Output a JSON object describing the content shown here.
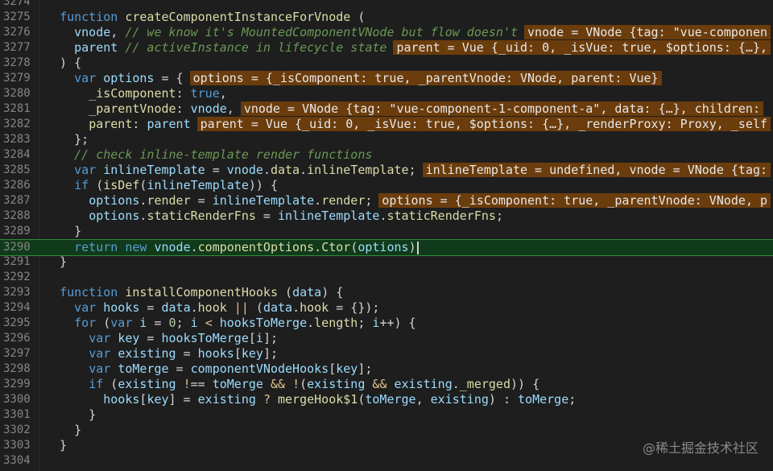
{
  "lines": [
    {
      "n": "3274",
      "t": ""
    },
    {
      "n": "3275",
      "t": "  function createComponentInstanceForVnode ("
    },
    {
      "n": "3276",
      "t": "    vnode, // we know it's MountedComponentVNode but flow doesn't",
      "inline": "vnode = VNode {tag: \"vue-componen"
    },
    {
      "n": "3277",
      "t": "    parent // activeInstance in lifecycle state",
      "inline": "parent = Vue {_uid: 0, _isVue: true, $options: {…},"
    },
    {
      "n": "3278",
      "t": "  ) {"
    },
    {
      "n": "3279",
      "t": "    var options = {",
      "inline": "options = {_isComponent: true, _parentVnode: VNode, parent: Vue}"
    },
    {
      "n": "3280",
      "t": "      _isComponent: true,"
    },
    {
      "n": "3281",
      "t": "      _parentVnode: vnode,",
      "inline": "vnode = VNode {tag: \"vue-component-1-component-a\", data: {…}, children:"
    },
    {
      "n": "3282",
      "t": "      parent: parent",
      "inline": "parent = Vue {_uid: 0, _isVue: true, $options: {…}, _renderProxy: Proxy, _self"
    },
    {
      "n": "3283",
      "t": "    };"
    },
    {
      "n": "3284",
      "t": "    // check inline-template render functions"
    },
    {
      "n": "3285",
      "t": "    var inlineTemplate = vnode.data.inlineTemplate;",
      "inline": "inlineTemplate = undefined, vnode = VNode {tag:"
    },
    {
      "n": "3286",
      "t": "    if (isDef(inlineTemplate)) {"
    },
    {
      "n": "3287",
      "t": "      options.render = inlineTemplate.render;",
      "inline": "options = {_isComponent: true, _parentVnode: VNode, p"
    },
    {
      "n": "3288",
      "t": "      options.staticRenderFns = inlineTemplate.staticRenderFns;"
    },
    {
      "n": "3289",
      "t": "    }"
    },
    {
      "n": "3290",
      "t": "    return new vnode.componentOptions.Ctor(options)",
      "current": true
    },
    {
      "n": "3291",
      "t": "  }"
    },
    {
      "n": "3292",
      "t": ""
    },
    {
      "n": "3293",
      "t": "  function installComponentHooks (data) {"
    },
    {
      "n": "3294",
      "t": "    var hooks = data.hook || (data.hook = {});"
    },
    {
      "n": "3295",
      "t": "    for (var i = 0; i < hooksToMerge.length; i++) {"
    },
    {
      "n": "3296",
      "t": "      var key = hooksToMerge[i];"
    },
    {
      "n": "3297",
      "t": "      var existing = hooks[key];"
    },
    {
      "n": "3298",
      "t": "      var toMerge = componentVNodeHooks[key];"
    },
    {
      "n": "3299",
      "t": "      if (existing !== toMerge && !(existing && existing._merged)) {"
    },
    {
      "n": "3300",
      "t": "        hooks[key] = existing ? mergeHook$1(toMerge, existing) : toMerge;"
    },
    {
      "n": "3301",
      "t": "      }"
    },
    {
      "n": "3302",
      "t": "    }"
    },
    {
      "n": "3303",
      "t": "  }"
    },
    {
      "n": "3304",
      "t": ""
    }
  ],
  "watermark": "@稀土掘金技术社区",
  "colors": {
    "background": "#1e1e1e",
    "inline_value_bg": "#6b3c0c",
    "current_line_bg": "#113a1a",
    "current_line_border": "#2f8a3a"
  }
}
